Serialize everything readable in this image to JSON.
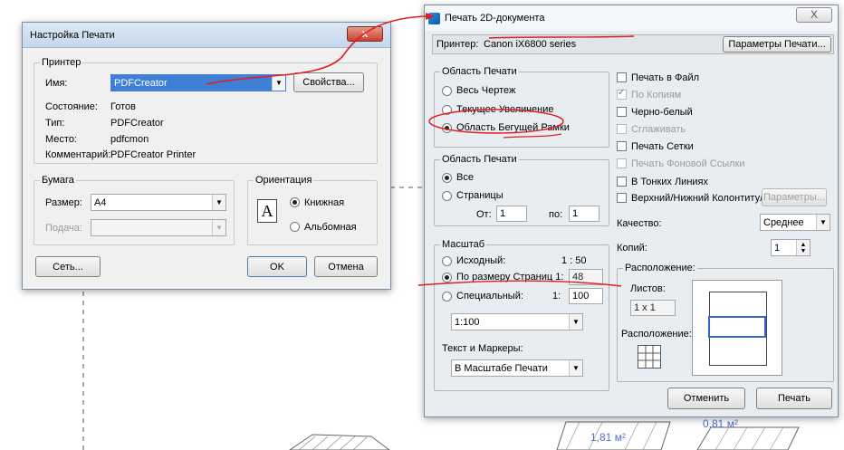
{
  "print_setup": {
    "title": "Настройка Печати",
    "close": "x",
    "printer_group": "Принтер",
    "name_label": "Имя:",
    "name_value": "PDFCreator",
    "properties_button": "Свойства...",
    "status_label": "Состояние:",
    "status_value": "Готов",
    "type_label": "Тип:",
    "type_value": "PDFCreator",
    "location_label": "Место:",
    "location_value": "pdfcmon",
    "comment_label": "Комментарий:",
    "comment_value": "PDFCreator Printer",
    "paper_group": "Бумага",
    "size_label": "Размер:",
    "size_value": "A4",
    "source_label": "Подача:",
    "source_value": "",
    "orientation_group": "Ориентация",
    "portrait": "Книжная",
    "landscape": "Альбомная",
    "orientation_icon": "A",
    "network_button": "Сеть...",
    "ok_button": "OK",
    "cancel_button": "Отмена"
  },
  "print_2d": {
    "title": "Печать 2D-документа",
    "close": "X",
    "printer_label": "Принтер:",
    "printer_value": "Canon iX6800 series",
    "print_params_button": "Параметры Печати...",
    "area_group": "Область Печати",
    "area_options": [
      "Весь Чертеж",
      "Текущее Увеличение",
      "Область Бегущей Рамки"
    ],
    "area_selected": 2,
    "pages_group": "Область Печати",
    "pages_all": "Все",
    "pages_range": "Страницы",
    "from_label": "От:",
    "from_value": "1",
    "to_label": "по:",
    "to_value": "1",
    "scale_group": "Масштаб",
    "scale_original": "Исходный:",
    "scale_original_value": "1 : 50",
    "scale_fit": "По размеру Страниц 1:",
    "scale_fit_value": "48",
    "scale_custom": "Специальный:",
    "scale_custom_prefix": "1:",
    "scale_custom_value": "100",
    "scale_combo": "1:100",
    "text_markers_label": "Текст и Маркеры:",
    "text_markers_value": "В Масштабе Печати",
    "checks": [
      {
        "label": "Печать в Файл",
        "checked": false,
        "enabled": true
      },
      {
        "label": "По Копиям",
        "checked": true,
        "enabled": false
      },
      {
        "label": "Черно-белый",
        "checked": false,
        "enabled": true
      },
      {
        "label": "Сглаживать",
        "checked": false,
        "enabled": false
      },
      {
        "label": "Печать Сетки",
        "checked": false,
        "enabled": true
      },
      {
        "label": "Печать Фоновой Ссылки",
        "checked": false,
        "enabled": false
      },
      {
        "label": "В Тонких Линиях",
        "checked": false,
        "enabled": true
      },
      {
        "label": "Верхний/Нижний Колонтитул",
        "checked": false,
        "enabled": true
      }
    ],
    "header_params_button": "Параметры...",
    "quality_label": "Качество:",
    "quality_value": "Среднее",
    "copies_label": "Копий:",
    "copies_value": "1",
    "layout_group": "Расположение:",
    "sheets_label": "Листов:",
    "sheets_value": "1 x 1",
    "layout_label": "Расположение:",
    "cancel_button": "Отменить",
    "print_button": "Печать"
  },
  "drawing": {
    "area1": "1,81 м²",
    "area2": "0,81 м²"
  },
  "colors": {
    "annotation": "#e02020",
    "selection_blue": "#3366cc",
    "area_text": "#4a6fd0"
  }
}
